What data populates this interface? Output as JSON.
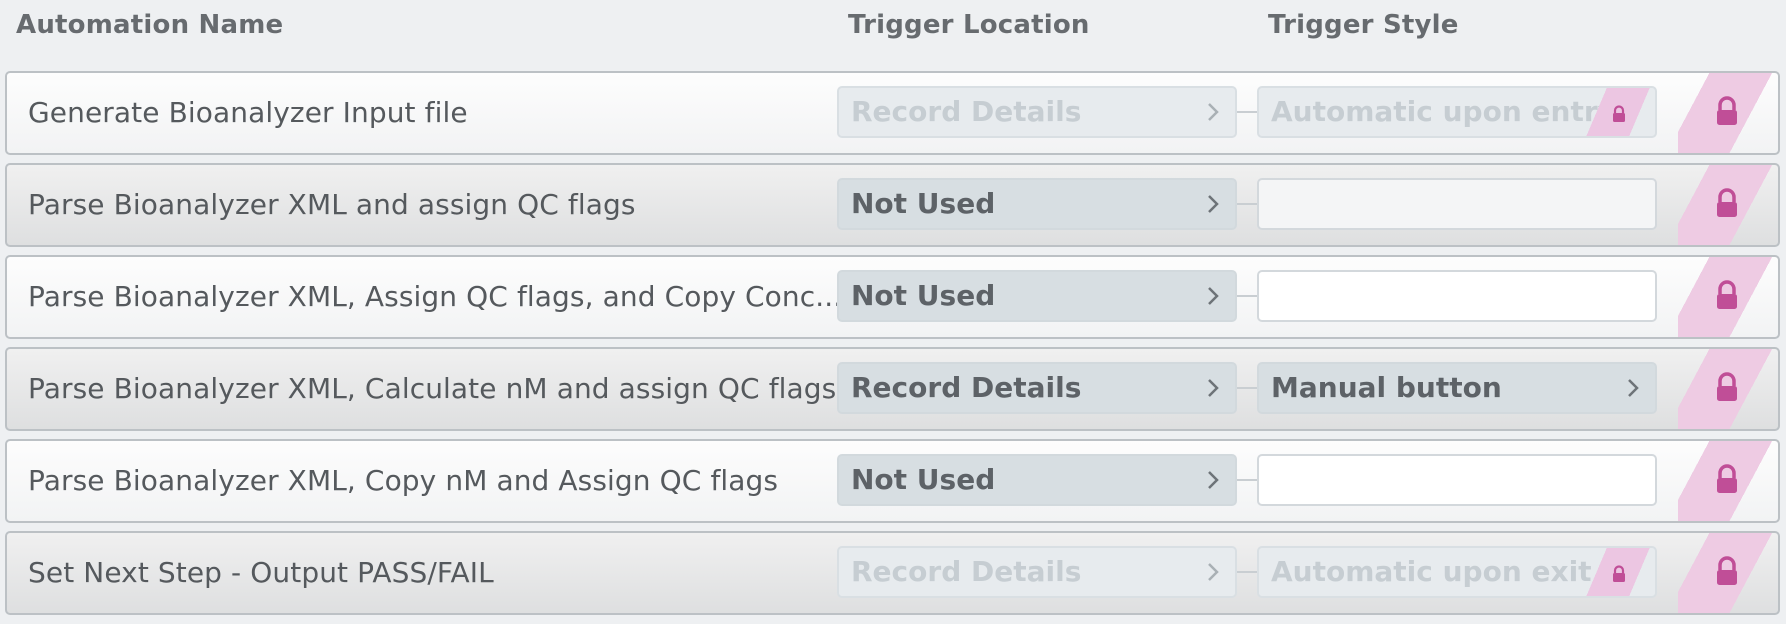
{
  "header": {
    "automation_name": "Automation Name",
    "trigger_location": "Trigger Location",
    "trigger_style": "Trigger Style"
  },
  "colors": {
    "lock": "#c04e97",
    "lock_stripe": "#eecbe3"
  },
  "icons": {
    "chevron": "chevron-right-icon",
    "lock": "lock-icon"
  },
  "rows": [
    {
      "name": "Generate Bioanalyzer Input file",
      "trigger_location": "Record Details",
      "trigger_style": "Automatic upon entry",
      "enabled": false
    },
    {
      "name": "Parse Bioanalyzer XML and assign QC flags",
      "trigger_location": "Not Used",
      "trigger_style": "",
      "enabled": true
    },
    {
      "name": "Parse Bioanalyzer XML, Assign QC flags, and Copy Conc...",
      "trigger_location": "Not Used",
      "trigger_style": "",
      "enabled": true
    },
    {
      "name": "Parse Bioanalyzer XML, Calculate nM and assign QC flags",
      "trigger_location": "Record Details",
      "trigger_style": "Manual button",
      "enabled": true
    },
    {
      "name": "Parse Bioanalyzer XML, Copy nM and Assign QC flags",
      "trigger_location": "Not Used",
      "trigger_style": "",
      "enabled": true
    },
    {
      "name": "Set Next Step - Output PASS/FAIL",
      "trigger_location": "Record Details",
      "trigger_style": "Automatic upon exit",
      "enabled": false
    }
  ]
}
